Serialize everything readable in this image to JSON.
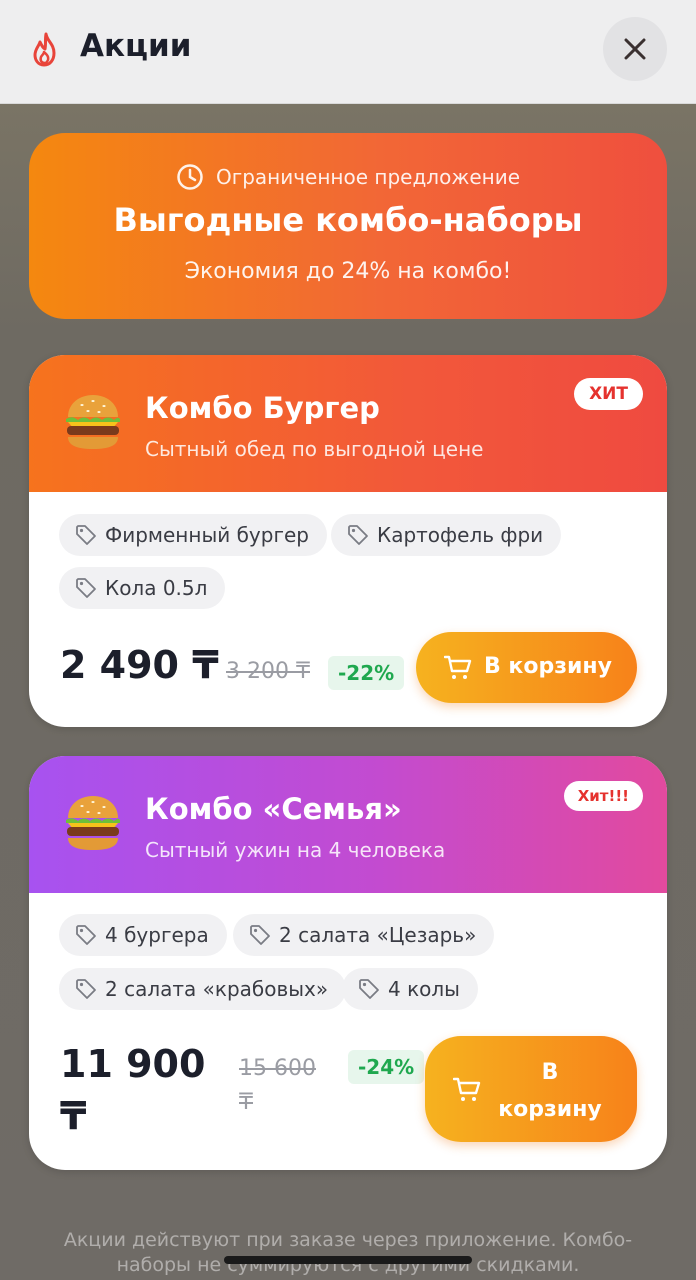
{
  "header": {
    "title": "Акции",
    "close_icon": "close-icon",
    "flame_icon": "flame-icon"
  },
  "hero": {
    "limited_text": "Ограниченное предложение",
    "title": "Выгодные комбо-наборы",
    "subtitle": "Экономия до 24% на комбо!"
  },
  "combos": [
    {
      "title": "Комбо Бургер",
      "subtitle": "Сытный обед по выгодной цене",
      "badge": "ХИТ",
      "items": [
        "Фирменный бургер",
        "Картофель фри",
        "Кола 0.5л"
      ],
      "price": "2 490 ₸",
      "old_price": "3 200 ₸",
      "discount": "-22%",
      "cart_label": "В корзину",
      "header_color": "#f2583a"
    },
    {
      "title": "Комбо «Семья»",
      "subtitle": "Сытный ужин на 4 человека",
      "badge": "Хит!!!",
      "items": [
        "4 бургера",
        "2 салата «Цезарь»",
        "2 салата «крабовых»",
        "4 колы"
      ],
      "price_line1": "11 900",
      "price_line2": "₸",
      "old_price_line1": "15 600",
      "old_price_line2": "₸",
      "discount": "-24%",
      "cart_line1": "В",
      "cart_line2": "корзину",
      "header_color": "#c34bd0"
    }
  ],
  "footer": {
    "line1": "Акции действуют при заказе через приложение. Комбо-",
    "line2": "наборы не суммируются с другими скидками."
  },
  "colors": {
    "accent_orange": "#f7821a",
    "discount_green": "#1fa84f",
    "badge_red": "#e5322e"
  }
}
